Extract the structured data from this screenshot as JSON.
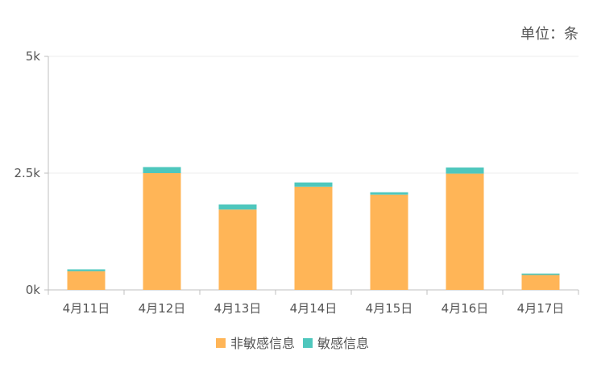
{
  "unit_label": "单位：条",
  "chart_data": {
    "type": "bar",
    "stacked": true,
    "categories": [
      "4月11日",
      "4月12日",
      "4月13日",
      "4月14日",
      "4月15日",
      "4月16日",
      "4月17日"
    ],
    "series": [
      {
        "name": "非敏感信息",
        "color": "#FFB557",
        "values": [
          400,
          2500,
          1720,
          2210,
          2040,
          2490,
          320
        ]
      },
      {
        "name": "敏感信息",
        "color": "#4EC7BD",
        "values": [
          40,
          130,
          110,
          90,
          50,
          130,
          30
        ]
      }
    ],
    "ylim": [
      0,
      5000
    ],
    "yticks": [
      {
        "value": 0,
        "label": "0k"
      },
      {
        "value": 2500,
        "label": "2.5k"
      },
      {
        "value": 5000,
        "label": "5k"
      }
    ],
    "grid": true,
    "legend": "bottom-center",
    "title": "",
    "xlabel": "",
    "ylabel": ""
  }
}
